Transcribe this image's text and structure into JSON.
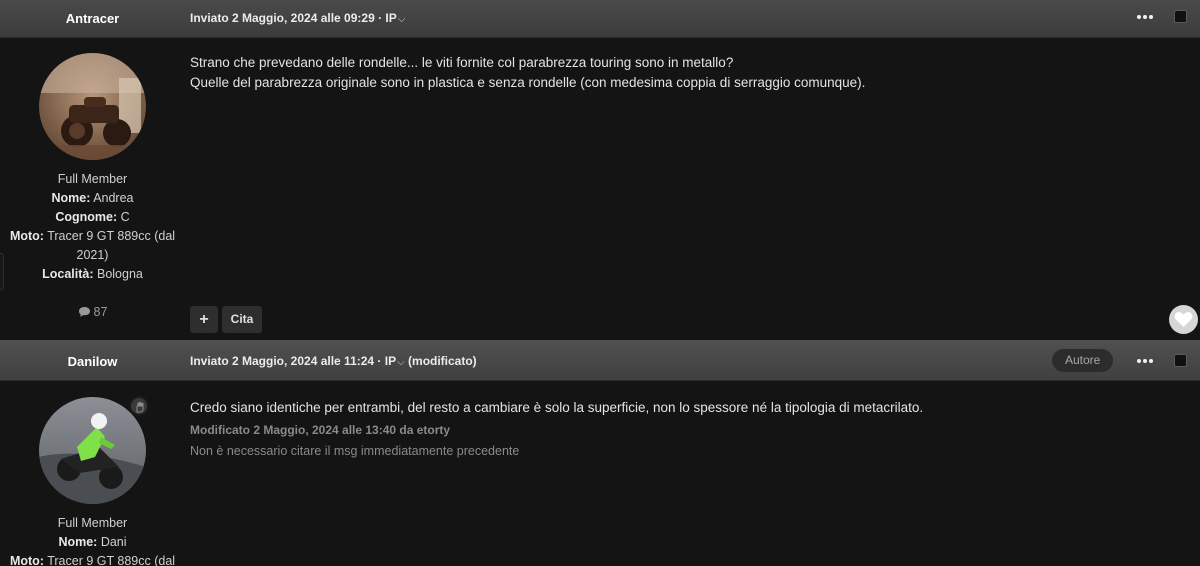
{
  "posts": [
    {
      "author": "Antracer",
      "meta": {
        "posted": "Inviato 2 Maggio, 2024 alle 09:29 · IP",
        "modified": ""
      },
      "author_info": {
        "rank": "Full Member",
        "fields": [
          {
            "label": "Nome:",
            "value": " Andrea"
          },
          {
            "label": "Cognome:",
            "value": " C"
          },
          {
            "label": "Moto:",
            "value": " Tracer 9 GT 889cc (dal 2021)"
          },
          {
            "label": "Località:",
            "value": " Bologna"
          }
        ],
        "post_count": "87"
      },
      "body": [
        "Strano che prevedano delle rondelle... le viti fornite col parabrezza touring sono in metallo?",
        "Quelle del parabrezza originale sono in plastica e senza rondelle (con medesima coppia di serraggio comunque)."
      ],
      "actions": {
        "add_label": "+",
        "quote_label": "Cita"
      }
    },
    {
      "author": "Danilow",
      "badge": "Autore",
      "meta": {
        "posted": "Inviato 2 Maggio, 2024 alle 11:24 · IP",
        "modified": " (modificato)"
      },
      "author_info": {
        "rank": "Full Member",
        "fields": [
          {
            "label": "Nome:",
            "value": " Dani"
          },
          {
            "label": "Moto:",
            "value": " Tracer 9 GT 889cc (dal"
          }
        ]
      },
      "body": [
        "Credo siano identiche per entrambi, del resto a cambiare è solo la superficie, non lo spessore né la tipologia di metacrilato."
      ],
      "edit_note": "Modificato 2 Maggio, 2024 alle 13:40 da etorty",
      "edit_reason": "Non è necessario citare il msg immediatamente precedente"
    }
  ],
  "icons": {
    "more": "ellipsis-icon",
    "comment": "comment-icon",
    "heart": "heart-icon",
    "chevron": "chevron-down-icon",
    "online": "hand-icon"
  },
  "colors": {
    "header_bg": "#444444",
    "page_bg": "#141414",
    "text": "#e4e4e4",
    "muted": "#8a8a8a"
  }
}
